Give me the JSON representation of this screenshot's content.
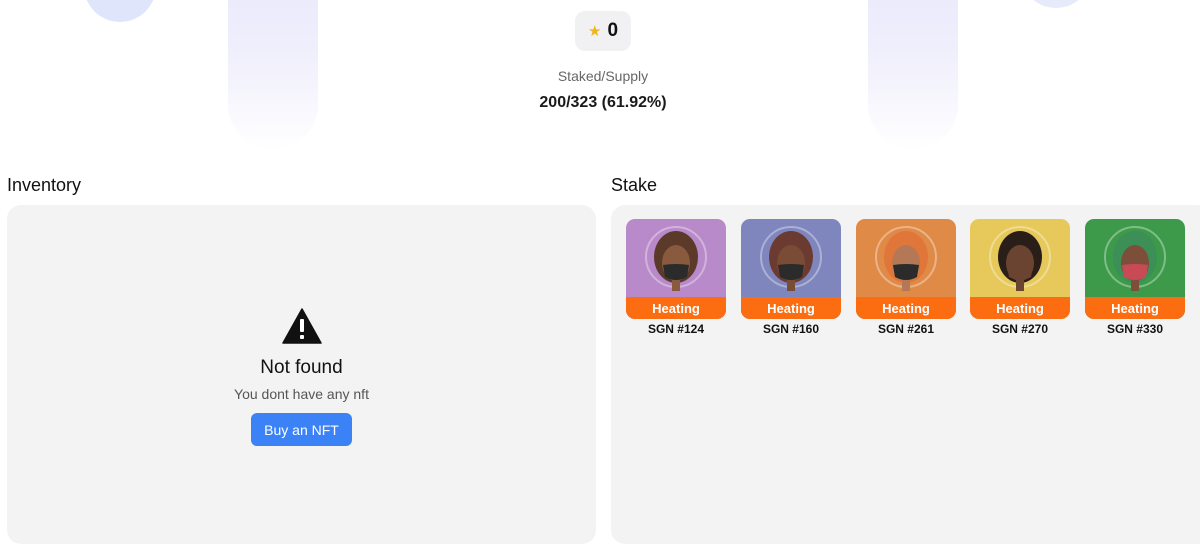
{
  "stats": {
    "points_value": "0",
    "points_icon": "star-icon",
    "staked_label": "Staked/Supply",
    "staked_value": "200/323 (61.92%)"
  },
  "inventory": {
    "title": "Inventory",
    "empty_icon": "warning-icon",
    "empty_title": "Not found",
    "empty_subtitle": "You dont have any nft",
    "buy_label": "Buy an NFT"
  },
  "stake": {
    "title": "Stake",
    "nfts": [
      {
        "name": "SGN #124",
        "status": "Heating",
        "bg": "#b98ac9",
        "mask": "#2b2b2b",
        "hair": "#5b3a2a",
        "skin": "#8a5a3e"
      },
      {
        "name": "SGN #160",
        "status": "Heating",
        "bg": "#7f86bd",
        "mask": "#2b2b2b",
        "hair": "#6b3b32",
        "skin": "#7a4c36"
      },
      {
        "name": "SGN #261",
        "status": "Heating",
        "bg": "#e08a48",
        "mask": "#2b2b2b",
        "hair": "#e0763a",
        "skin": "#b57856"
      },
      {
        "name": "SGN #270",
        "status": "Heating",
        "bg": "#e6c95a",
        "mask": "#6b4431",
        "hair": "#2a1e18",
        "skin": "#6b4431"
      },
      {
        "name": "SGN #330",
        "status": "Heating",
        "bg": "#3d9a4a",
        "mask": "#c84a57",
        "hair": "#3b8f57",
        "skin": "#7d4f3a"
      }
    ]
  },
  "colors": {
    "accent": "#3b82f6",
    "badge": "#fb6d10",
    "panel": "#f3f3f3"
  }
}
